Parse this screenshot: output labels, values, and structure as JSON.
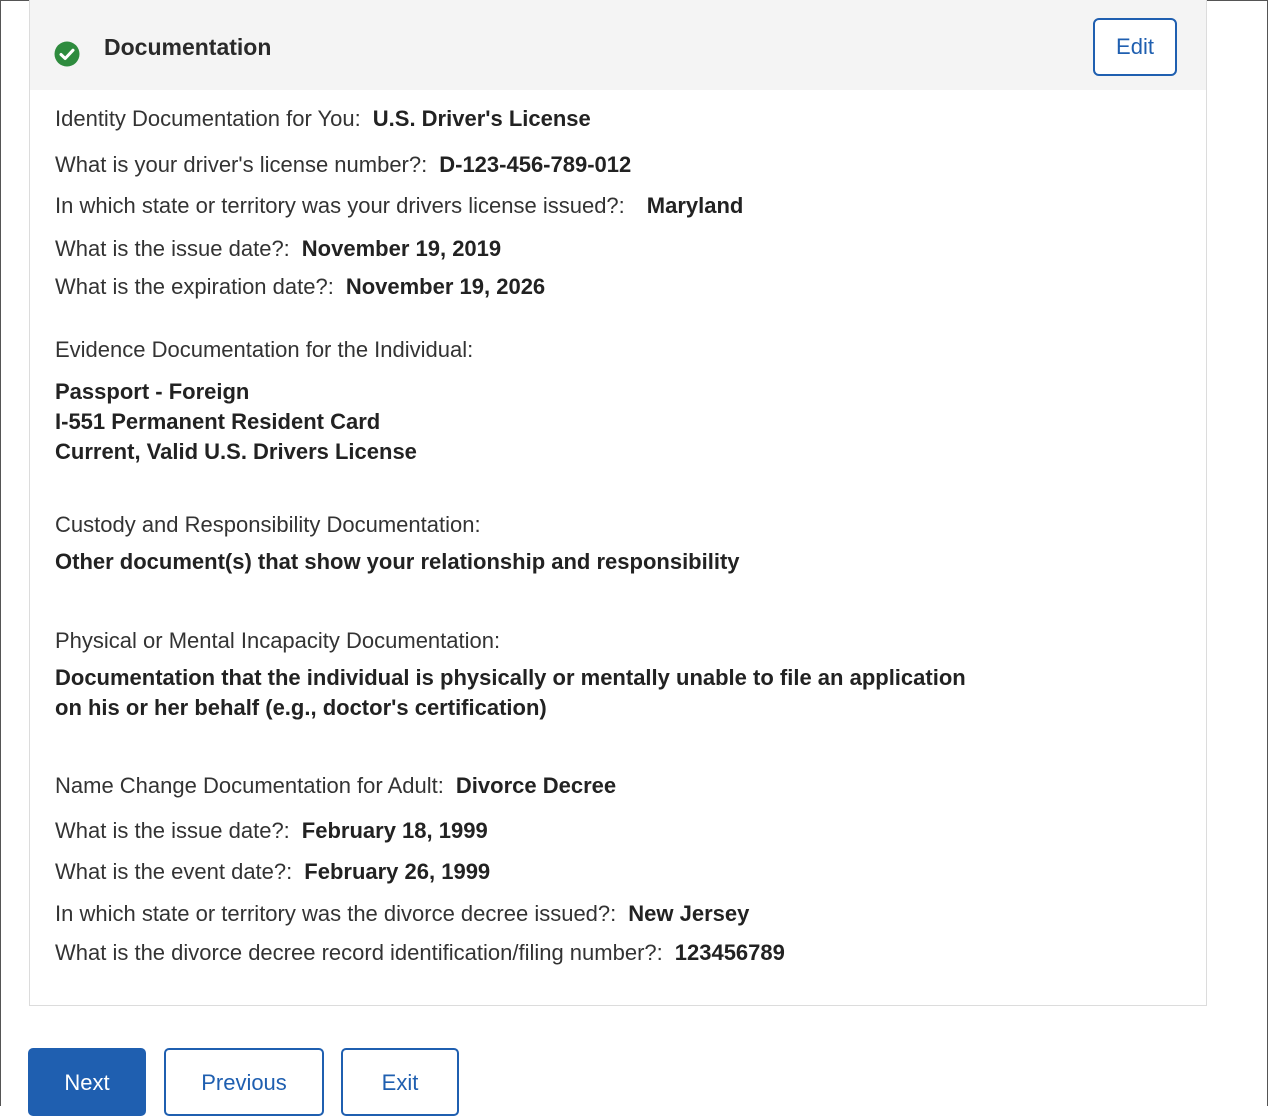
{
  "section": {
    "title": "Documentation",
    "edit_label": "Edit",
    "status_icon": "check-circle-icon",
    "status_color": "#2e8b3e"
  },
  "identity": {
    "doc_label": "Identity Documentation for You:",
    "doc_value": "U.S. Driver's License",
    "license_number_label": "What is your driver's license number?:",
    "license_number_value": "D-123-456-789-012",
    "state_label": "In which state or territory was your drivers license issued?:",
    "state_value": "Maryland",
    "issue_date_label": "What is the issue date?:",
    "issue_date_value": "November 19, 2019",
    "expiration_label": "What is the expiration date?:",
    "expiration_value": "November 19, 2026"
  },
  "evidence": {
    "label": "Evidence Documentation for the Individual:",
    "items": [
      "Passport - Foreign",
      "I-551 Permanent Resident Card",
      "Current, Valid U.S. Drivers License"
    ]
  },
  "custody": {
    "label": "Custody and Responsibility Documentation:",
    "value": "Other document(s) that show your relationship and responsibility"
  },
  "incapacity": {
    "label": "Physical or Mental Incapacity Documentation:",
    "value_line1": "Documentation that the individual is physically or mentally unable to file an application",
    "value_line2": "on his or her behalf (e.g., doctor's certification)"
  },
  "name_change": {
    "doc_label": "Name Change Documentation for Adult:",
    "doc_value": "Divorce Decree",
    "issue_date_label": "What is the issue date?:",
    "issue_date_value": "February 18, 1999",
    "event_date_label": "What is the event date?:",
    "event_date_value": "February 26, 1999",
    "state_label": "In which state or territory was the divorce decree issued?:",
    "state_value": "New Jersey",
    "record_label": "What is the divorce decree record identification/filing number?:",
    "record_value": "123456789"
  },
  "nav": {
    "next_label": "Next",
    "previous_label": "Previous",
    "exit_label": "Exit",
    "accent_color": "#1f5fb0"
  }
}
